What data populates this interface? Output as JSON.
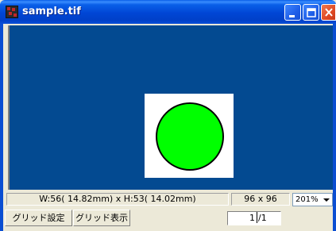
{
  "window": {
    "title": "sample.tif"
  },
  "status": {
    "dimensions": "W:56( 14.82mm) x H:53( 14.02mm)",
    "resolution": "96 x 96",
    "zoom_value": "201%"
  },
  "toolbar": {
    "grid_settings_label": "グリッド設定",
    "grid_display_label": "グリッド表示"
  },
  "pager": {
    "current_page": "1",
    "total_pages": "/1"
  },
  "colors": {
    "canvas_bg": "#034a91",
    "circle_fill": "#00ff00",
    "circle_stroke": "#000000"
  },
  "icons": {
    "minimize": "minimize-icon",
    "maximize": "maximize-icon",
    "close": "close-icon",
    "app": "app-icon",
    "dropdown": "chevron-down-icon"
  }
}
